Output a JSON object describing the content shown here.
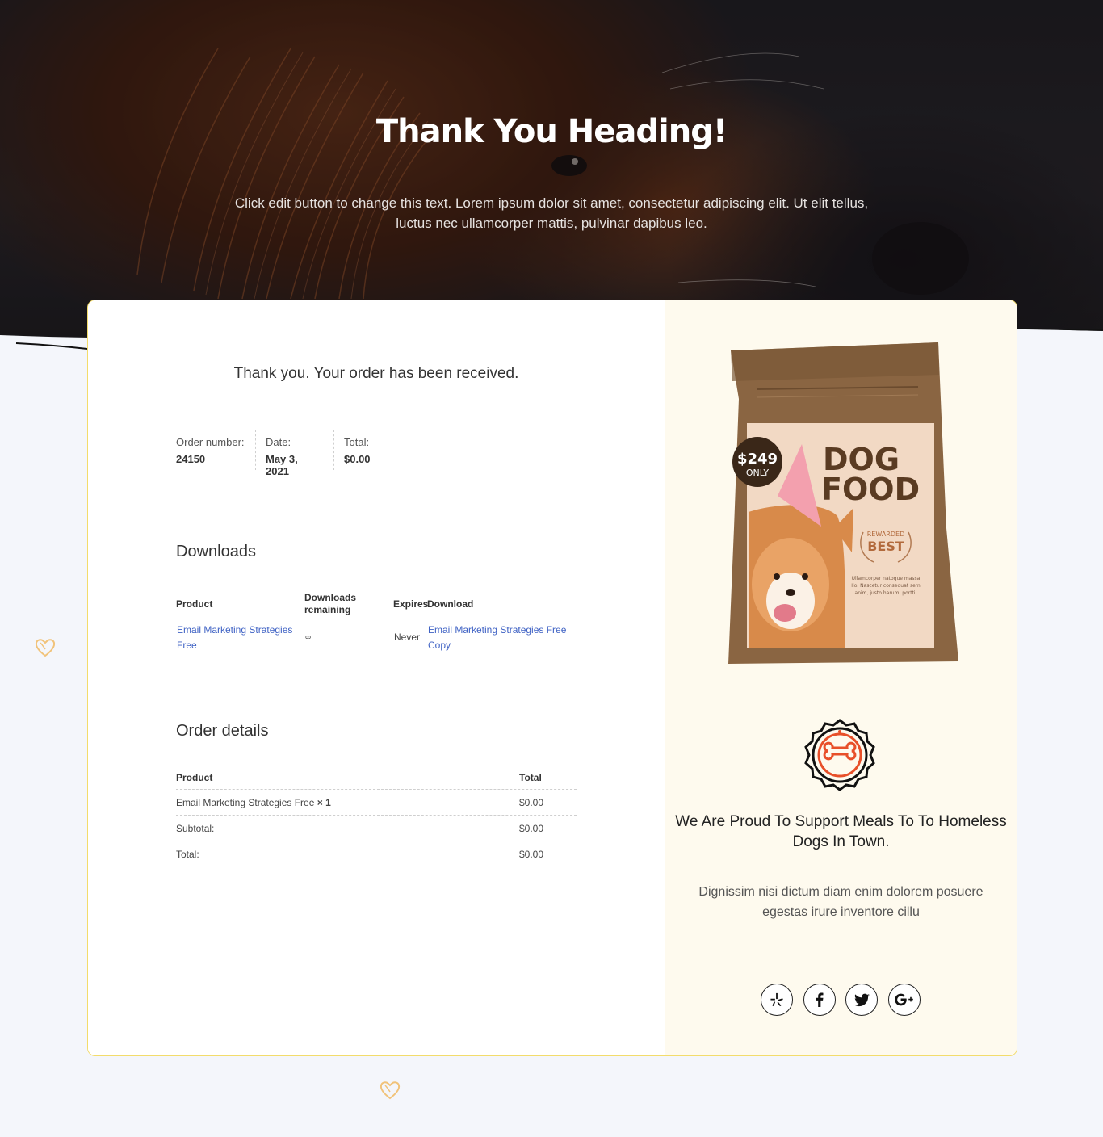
{
  "hero": {
    "title": "Thank You Heading!",
    "text": "Click edit button to change this text. Lorem ipsum dolor sit amet, consectetur adipiscing elit. Ut elit tellus, luctus nec ullamcorper mattis, pulvinar dapibus leo."
  },
  "order": {
    "received_message": "Thank you. Your order has been received.",
    "overview": {
      "number_label": "Order number:",
      "number_value": "24150",
      "date_label": "Date:",
      "date_value": "May 3, 2021",
      "total_label": "Total:",
      "total_value": "$0.00"
    },
    "downloads": {
      "title": "Downloads",
      "headers": {
        "product": "Product",
        "remaining": "Downloads remaining",
        "expires": "Expires",
        "download": "Download"
      },
      "row": {
        "product_line1": "Email Marketing Strategies",
        "product_line2": "Free",
        "remaining": "∞",
        "expires": "Never",
        "download_line1": "Email Marketing Strategies Free",
        "download_line2": "Copy"
      }
    },
    "details": {
      "title": "Order details",
      "header_product": "Product",
      "header_total": "Total",
      "item_name": "Email Marketing Strategies Free",
      "item_qty": "× 1",
      "item_total": "$0.00",
      "subtotal_label": "Subtotal:",
      "subtotal_value": "$0.00",
      "total_label": "Total:",
      "total_value": "$0.00"
    }
  },
  "promo": {
    "bag": {
      "price": "$249",
      "price_note": "ONLY",
      "brand_line1": "DOG",
      "brand_line2": "FOOD",
      "award_top": "REWARDED",
      "award_main": "BEST",
      "small_text": "Ullamcorper natoque massa Ilo. Nascetur consequat sem anim, justo harum, portti."
    },
    "support_title": "We Are Proud To Support Meals To To Homeless Dogs In Town.",
    "support_text": "Dignissim nisi dictum diam enim dolorem posuere egestas irure inventore cillu",
    "socials": [
      "yelp-icon",
      "facebook-icon",
      "twitter-icon",
      "google-plus-icon"
    ]
  },
  "colors": {
    "accent_border": "#f3dc6b",
    "link": "#3f62c4",
    "panel_bg": "#fefaee",
    "page_bg": "#f4f6fb",
    "icon_orange": "#e8502a"
  }
}
